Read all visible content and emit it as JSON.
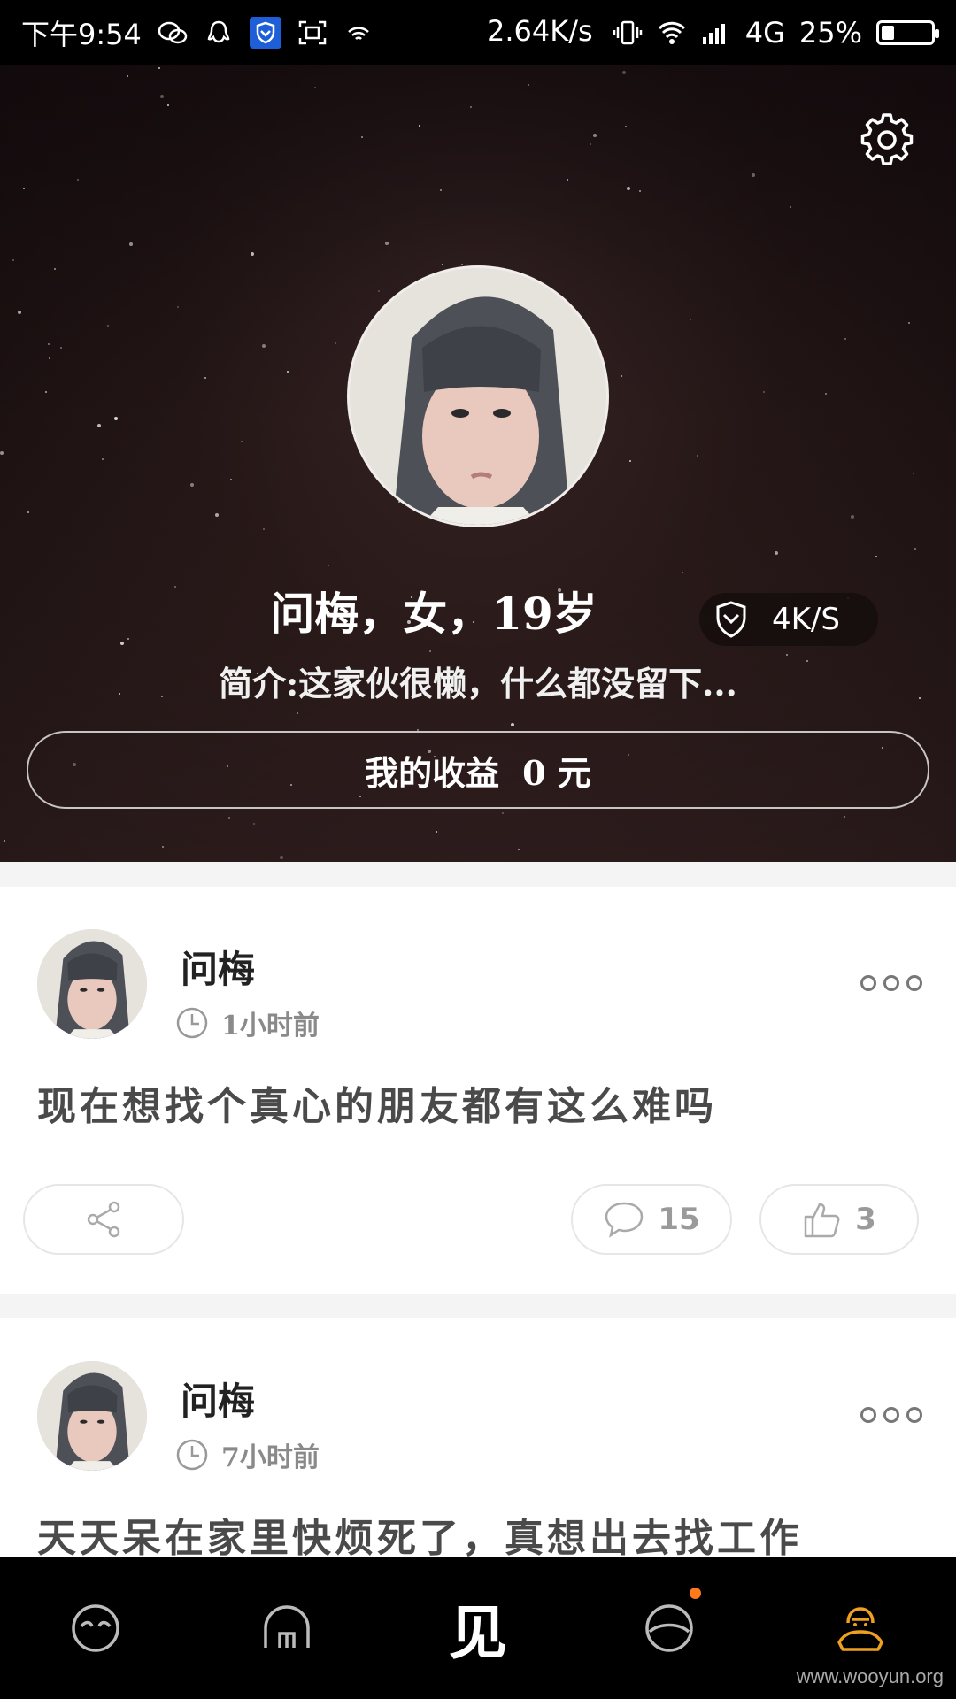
{
  "status_bar": {
    "time": "下午9:54",
    "net_speed": "2.64K/s",
    "network": "4G",
    "battery": "25%",
    "battery_level": 0.25
  },
  "profile": {
    "line": "问梅，女，19岁",
    "speed_badge": "4K/S",
    "bio": "简介:这家伙很懒，什么都没留下...",
    "income_label": "我的收益",
    "income_value": "0 元"
  },
  "posts": [
    {
      "author": "问梅",
      "time": "1小时前",
      "content": "现在想找个真心的朋友都有这么难吗",
      "comments": "15",
      "likes": "3"
    },
    {
      "author": "问梅",
      "time": "7小时前",
      "content": "天天呆在家里快烦死了，真想出去找工作"
    }
  ],
  "nav": {
    "center_label": "见"
  },
  "watermark": "www.wooyun.org",
  "colors": {
    "accent": "#ff7a1a",
    "nav_active": "#f0a020"
  }
}
